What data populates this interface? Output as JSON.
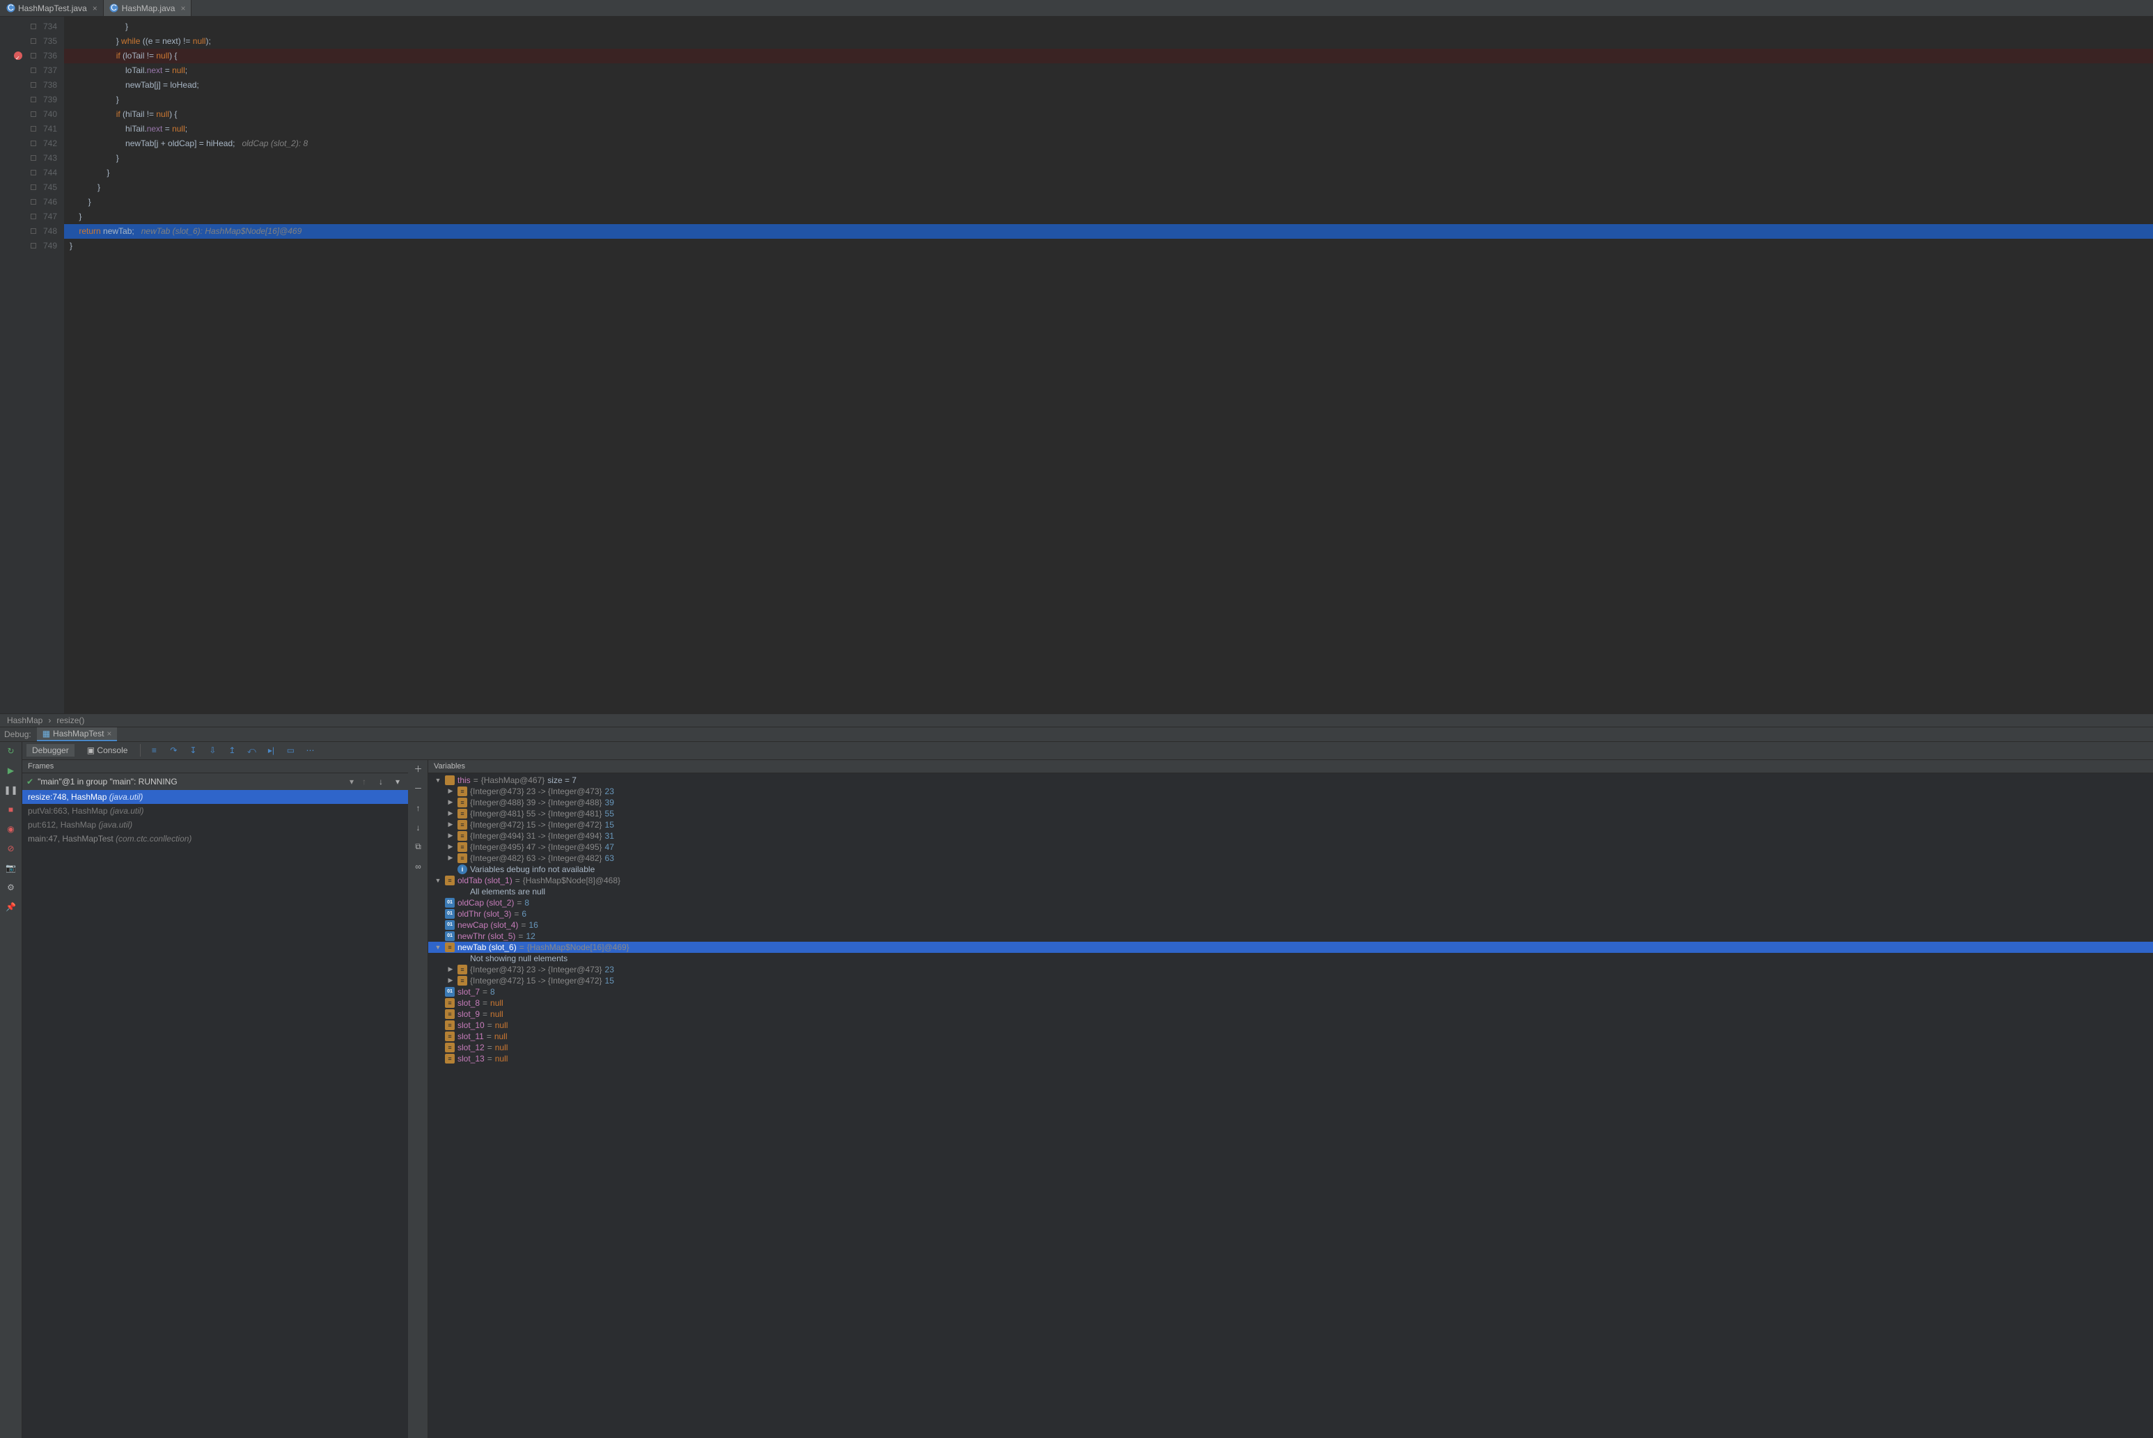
{
  "tabs": [
    {
      "label": "HashMapTest.java",
      "active": false,
      "icon": "class"
    },
    {
      "label": "HashMap.java",
      "active": true,
      "icon": "class"
    }
  ],
  "editor": {
    "first_line": 734,
    "exec_line": 748,
    "breakpoint_line": 736,
    "lines": [
      {
        "n": 734,
        "indent": 24,
        "tokens": [
          [
            "ident",
            "}"
          ]
        ]
      },
      {
        "n": 735,
        "indent": 20,
        "tokens": [
          [
            "ident",
            "} "
          ],
          [
            "kw",
            "while"
          ],
          [
            "ident",
            " ((e = next) != "
          ],
          [
            "kw",
            "null"
          ],
          [
            "ident",
            ");"
          ]
        ]
      },
      {
        "n": 736,
        "indent": 20,
        "tokens": [
          [
            "kw",
            "if"
          ],
          [
            "ident",
            " (loTail != "
          ],
          [
            "kw",
            "null"
          ],
          [
            "ident",
            ") {"
          ]
        ]
      },
      {
        "n": 737,
        "indent": 24,
        "tokens": [
          [
            "ident",
            "loTail."
          ],
          [
            "field",
            "next"
          ],
          [
            "ident",
            " = "
          ],
          [
            "kw",
            "null"
          ],
          [
            "ident",
            ";"
          ]
        ]
      },
      {
        "n": 738,
        "indent": 24,
        "tokens": [
          [
            "ident",
            "newTab[j] = loHead;"
          ]
        ]
      },
      {
        "n": 739,
        "indent": 20,
        "tokens": [
          [
            "ident",
            "}"
          ]
        ]
      },
      {
        "n": 740,
        "indent": 20,
        "tokens": [
          [
            "kw",
            "if"
          ],
          [
            "ident",
            " (hiTail != "
          ],
          [
            "kw",
            "null"
          ],
          [
            "ident",
            ") {"
          ]
        ]
      },
      {
        "n": 741,
        "indent": 24,
        "tokens": [
          [
            "ident",
            "hiTail."
          ],
          [
            "field",
            "next"
          ],
          [
            "ident",
            " = "
          ],
          [
            "kw",
            "null"
          ],
          [
            "ident",
            ";"
          ]
        ]
      },
      {
        "n": 742,
        "indent": 24,
        "tokens": [
          [
            "ident",
            "newTab[j + oldCap] = hiHead;   "
          ],
          [
            "cmnt",
            "oldCap (slot_2): 8"
          ]
        ]
      },
      {
        "n": 743,
        "indent": 20,
        "tokens": [
          [
            "ident",
            "}"
          ]
        ]
      },
      {
        "n": 744,
        "indent": 16,
        "tokens": [
          [
            "ident",
            "}"
          ]
        ]
      },
      {
        "n": 745,
        "indent": 12,
        "tokens": [
          [
            "ident",
            "}"
          ]
        ]
      },
      {
        "n": 746,
        "indent": 8,
        "tokens": [
          [
            "ident",
            "}"
          ]
        ]
      },
      {
        "n": 747,
        "indent": 4,
        "tokens": [
          [
            "ident",
            "}"
          ]
        ]
      },
      {
        "n": 748,
        "indent": 4,
        "tokens": [
          [
            "kw",
            "return"
          ],
          [
            "ident",
            " newTab;   "
          ],
          [
            "cmnt",
            "newTab (slot_6): HashMap$Node[16]@469"
          ]
        ]
      },
      {
        "n": 749,
        "indent": 0,
        "tokens": [
          [
            "ident",
            "}"
          ]
        ]
      }
    ]
  },
  "breadcrumbs": [
    "HashMap",
    "resize()"
  ],
  "debug": {
    "label": "Debug:",
    "config": "HashMapTest",
    "toolbar": {
      "tabs": [
        "Debugger",
        "Console"
      ]
    },
    "frames_title": "Frames",
    "vars_title": "Variables",
    "thread": "\"main\"@1 in group \"main\": RUNNING",
    "frames": [
      {
        "text": "resize:748, HashMap ",
        "pkg": "(java.util)",
        "sel": true,
        "lib": false
      },
      {
        "text": "putVal:663, HashMap ",
        "pkg": "(java.util)",
        "sel": false,
        "lib": true
      },
      {
        "text": "put:612, HashMap ",
        "pkg": "(java.util)",
        "sel": false,
        "lib": true
      },
      {
        "text": "main:47, HashMapTest ",
        "pkg": "(com.ctc.conllection)",
        "sel": false,
        "lib": false
      }
    ],
    "variables": [
      {
        "d": 0,
        "tw": "▼",
        "icon": "obj",
        "name": "this",
        "eq": " = ",
        "val": "{HashMap@467}  ",
        "extra": "size = 7",
        "extraClass": "ident"
      },
      {
        "d": 1,
        "tw": "▶",
        "icon": "arr",
        "val": "{Integer@473} 23 -> {Integer@473} ",
        "lit": "23"
      },
      {
        "d": 1,
        "tw": "▶",
        "icon": "arr",
        "val": "{Integer@488} 39 -> {Integer@488} ",
        "lit": "39"
      },
      {
        "d": 1,
        "tw": "▶",
        "icon": "arr",
        "val": "{Integer@481} 55 -> {Integer@481} ",
        "lit": "55"
      },
      {
        "d": 1,
        "tw": "▶",
        "icon": "arr",
        "val": "{Integer@472} 15 -> {Integer@472} ",
        "lit": "15"
      },
      {
        "d": 1,
        "tw": "▶",
        "icon": "arr",
        "val": "{Integer@494} 31 -> {Integer@494} ",
        "lit": "31"
      },
      {
        "d": 1,
        "tw": "▶",
        "icon": "arr",
        "val": "{Integer@495} 47 -> {Integer@495} ",
        "lit": "47"
      },
      {
        "d": 1,
        "tw": "▶",
        "icon": "arr",
        "val": "{Integer@482} 63 -> {Integer@482} ",
        "lit": "63"
      },
      {
        "d": 1,
        "tw": "",
        "icon": "info",
        "plain": "Variables debug info not available"
      },
      {
        "d": 0,
        "tw": "▼",
        "icon": "arr",
        "name": "oldTab (slot_1)",
        "eq": " = ",
        "val": "{HashMap$Node[8]@468}"
      },
      {
        "d": 1,
        "tw": "",
        "icon": "",
        "plain": "All elements are null"
      },
      {
        "d": 0,
        "tw": "",
        "icon": "prim",
        "name": "oldCap (slot_2)",
        "eq": " = ",
        "lit": "8"
      },
      {
        "d": 0,
        "tw": "",
        "icon": "prim",
        "name": "oldThr (slot_3)",
        "eq": " = ",
        "lit": "6"
      },
      {
        "d": 0,
        "tw": "",
        "icon": "prim",
        "name": "newCap (slot_4)",
        "eq": " = ",
        "lit": "16"
      },
      {
        "d": 0,
        "tw": "",
        "icon": "prim",
        "name": "newThr (slot_5)",
        "eq": " = ",
        "lit": "12"
      },
      {
        "d": 0,
        "tw": "▼",
        "icon": "arr",
        "name": "newTab (slot_6)",
        "eq": " = ",
        "val": "{HashMap$Node[16]@469}",
        "sel": true
      },
      {
        "d": 1,
        "tw": "",
        "icon": "",
        "plain": "Not showing null elements"
      },
      {
        "d": 1,
        "tw": "▶",
        "icon": "arr",
        "val": "{Integer@473} 23 -> {Integer@473} ",
        "lit": "23"
      },
      {
        "d": 1,
        "tw": "▶",
        "icon": "arr",
        "val": "{Integer@472} 15 -> {Integer@472} ",
        "lit": "15"
      },
      {
        "d": 0,
        "tw": "",
        "icon": "prim",
        "name": "slot_7",
        "eq": " = ",
        "lit": "8"
      },
      {
        "d": 0,
        "tw": "",
        "icon": "arr",
        "name": "slot_8",
        "eq": " = ",
        "null": "null"
      },
      {
        "d": 0,
        "tw": "",
        "icon": "arr",
        "name": "slot_9",
        "eq": " = ",
        "null": "null"
      },
      {
        "d": 0,
        "tw": "",
        "icon": "arr",
        "name": "slot_10",
        "eq": " = ",
        "null": "null"
      },
      {
        "d": 0,
        "tw": "",
        "icon": "arr",
        "name": "slot_11",
        "eq": " = ",
        "null": "null"
      },
      {
        "d": 0,
        "tw": "",
        "icon": "arr",
        "name": "slot_12",
        "eq": " = ",
        "null": "null"
      },
      {
        "d": 0,
        "tw": "",
        "icon": "arr",
        "name": "slot_13",
        "eq": " = ",
        "null": "null"
      }
    ]
  },
  "left_tool_icons": [
    "rerun",
    "resume",
    "pause",
    "stop",
    "view-bp",
    "mute-bp",
    "camera",
    "settings",
    "pin"
  ],
  "step_icons": [
    "show-exec",
    "step-over",
    "step-into",
    "force-into",
    "step-out",
    "drop-frame",
    "run-to-cursor",
    "evaluate",
    "trace"
  ],
  "vars_gutter_icons": [
    "add",
    "remove",
    "up",
    "down",
    "copy",
    "link"
  ]
}
